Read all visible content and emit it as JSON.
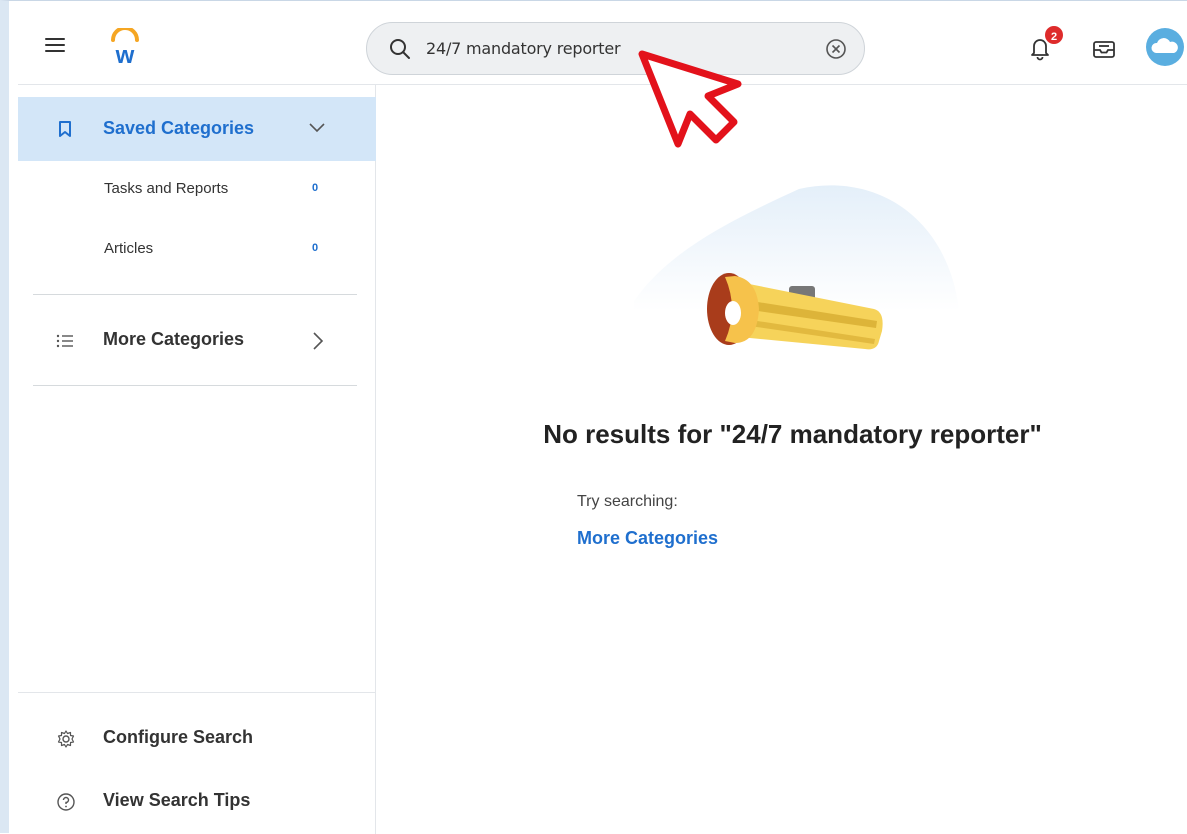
{
  "header": {
    "logo_letter": "w",
    "search": {
      "value": "24/7 mandatory reporter"
    },
    "notifications": {
      "count": "2"
    }
  },
  "sidebar": {
    "saved_categories": {
      "label": "Saved Categories",
      "items": [
        {
          "label": "Tasks and Reports",
          "count": "0"
        },
        {
          "label": "Articles",
          "count": "0"
        }
      ]
    },
    "more_categories": {
      "label": "More Categories"
    },
    "bottom": [
      {
        "label": "Configure Search",
        "icon": "gear-icon"
      },
      {
        "label": "View Search Tips",
        "icon": "help-circle-icon"
      }
    ]
  },
  "main": {
    "no_results_text": "No results for \"24/7 mandatory reporter\"",
    "try_label": "Try searching:",
    "suggestion_link": "More Categories"
  },
  "colors": {
    "accent": "#1f6fce",
    "selected_bg": "#d3e6f8",
    "badge": "#de2b2b",
    "logo_orange": "#f5a623",
    "logo_blue": "#1f6fce"
  }
}
